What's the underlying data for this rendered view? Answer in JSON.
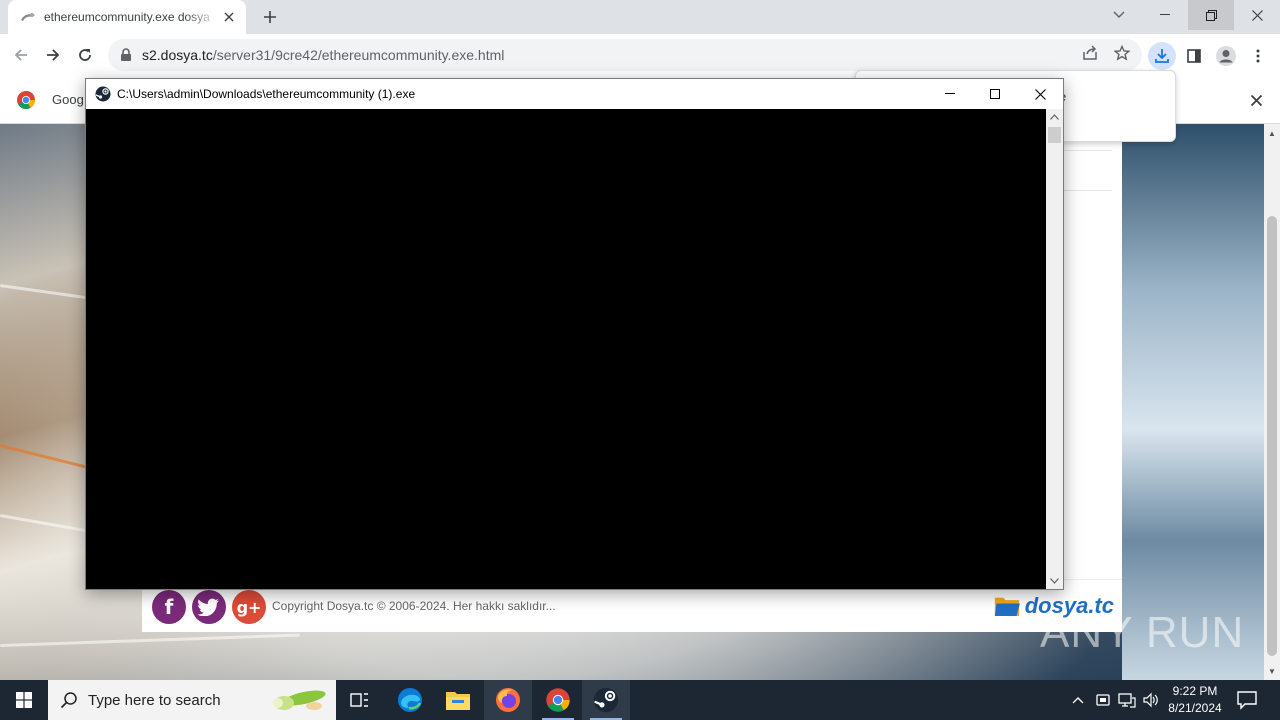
{
  "browser": {
    "tab": {
      "title": "ethereumcommunity.exe dosya"
    },
    "url": {
      "host": "s2.dosya.tc",
      "path": "/server31/9cre42/ethereumcommunity.exe.html"
    },
    "bookmarks_bar": {
      "text": "Goog"
    },
    "download_popup": {
      "peek_text": "e"
    }
  },
  "page": {
    "footer": {
      "copyright": "Copyright Dosya.tc © 2006-2024. Her hakkı saklıdır...",
      "logo_text": "dosya.tc",
      "social": {
        "facebook": "f",
        "google_plus": "g+"
      }
    }
  },
  "console": {
    "title": "C:\\Users\\admin\\Downloads\\ethereumcommunity (1).exe"
  },
  "taskbar": {
    "search_placeholder": "Type here to search",
    "time": "9:22 PM",
    "date": "8/21/2024"
  },
  "watermark": {
    "text": "ANY RUN"
  },
  "colors": {
    "accent": "#1a73e8",
    "taskbar": "#1c2733",
    "console_bg": "#000000"
  }
}
